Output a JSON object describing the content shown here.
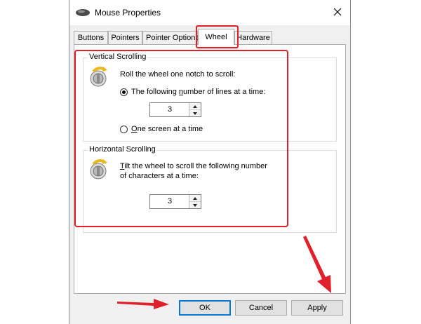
{
  "window": {
    "title": "Mouse Properties",
    "title_icon": "mouse-icon",
    "close_icon": "close-icon"
  },
  "tabs": [
    {
      "label": "Buttons",
      "active": false
    },
    {
      "label": "Pointers",
      "active": false
    },
    {
      "label": "Pointer Options",
      "active": false
    },
    {
      "label": "Wheel",
      "active": true
    },
    {
      "label": "Hardware",
      "active": false
    }
  ],
  "vertical": {
    "group_label": "Vertical Scrolling",
    "instruction": "Roll the wheel one notch to scroll:",
    "option_lines_pre": "The following ",
    "option_lines_u": "n",
    "option_lines_post": "umber of lines at a time:",
    "lines_value": "3",
    "option_screen_u": "O",
    "option_screen_post": "ne screen at a time",
    "selected": "lines"
  },
  "horizontal": {
    "group_label": "Horizontal Scrolling",
    "instruction_u": "T",
    "instruction_line1_post": "ilt the wheel to scroll the following number",
    "instruction_line2": "of characters at a time:",
    "chars_value": "3"
  },
  "buttons": {
    "ok": "OK",
    "cancel": "Cancel",
    "apply": "Apply"
  },
  "annotation_color": "#e0202a"
}
